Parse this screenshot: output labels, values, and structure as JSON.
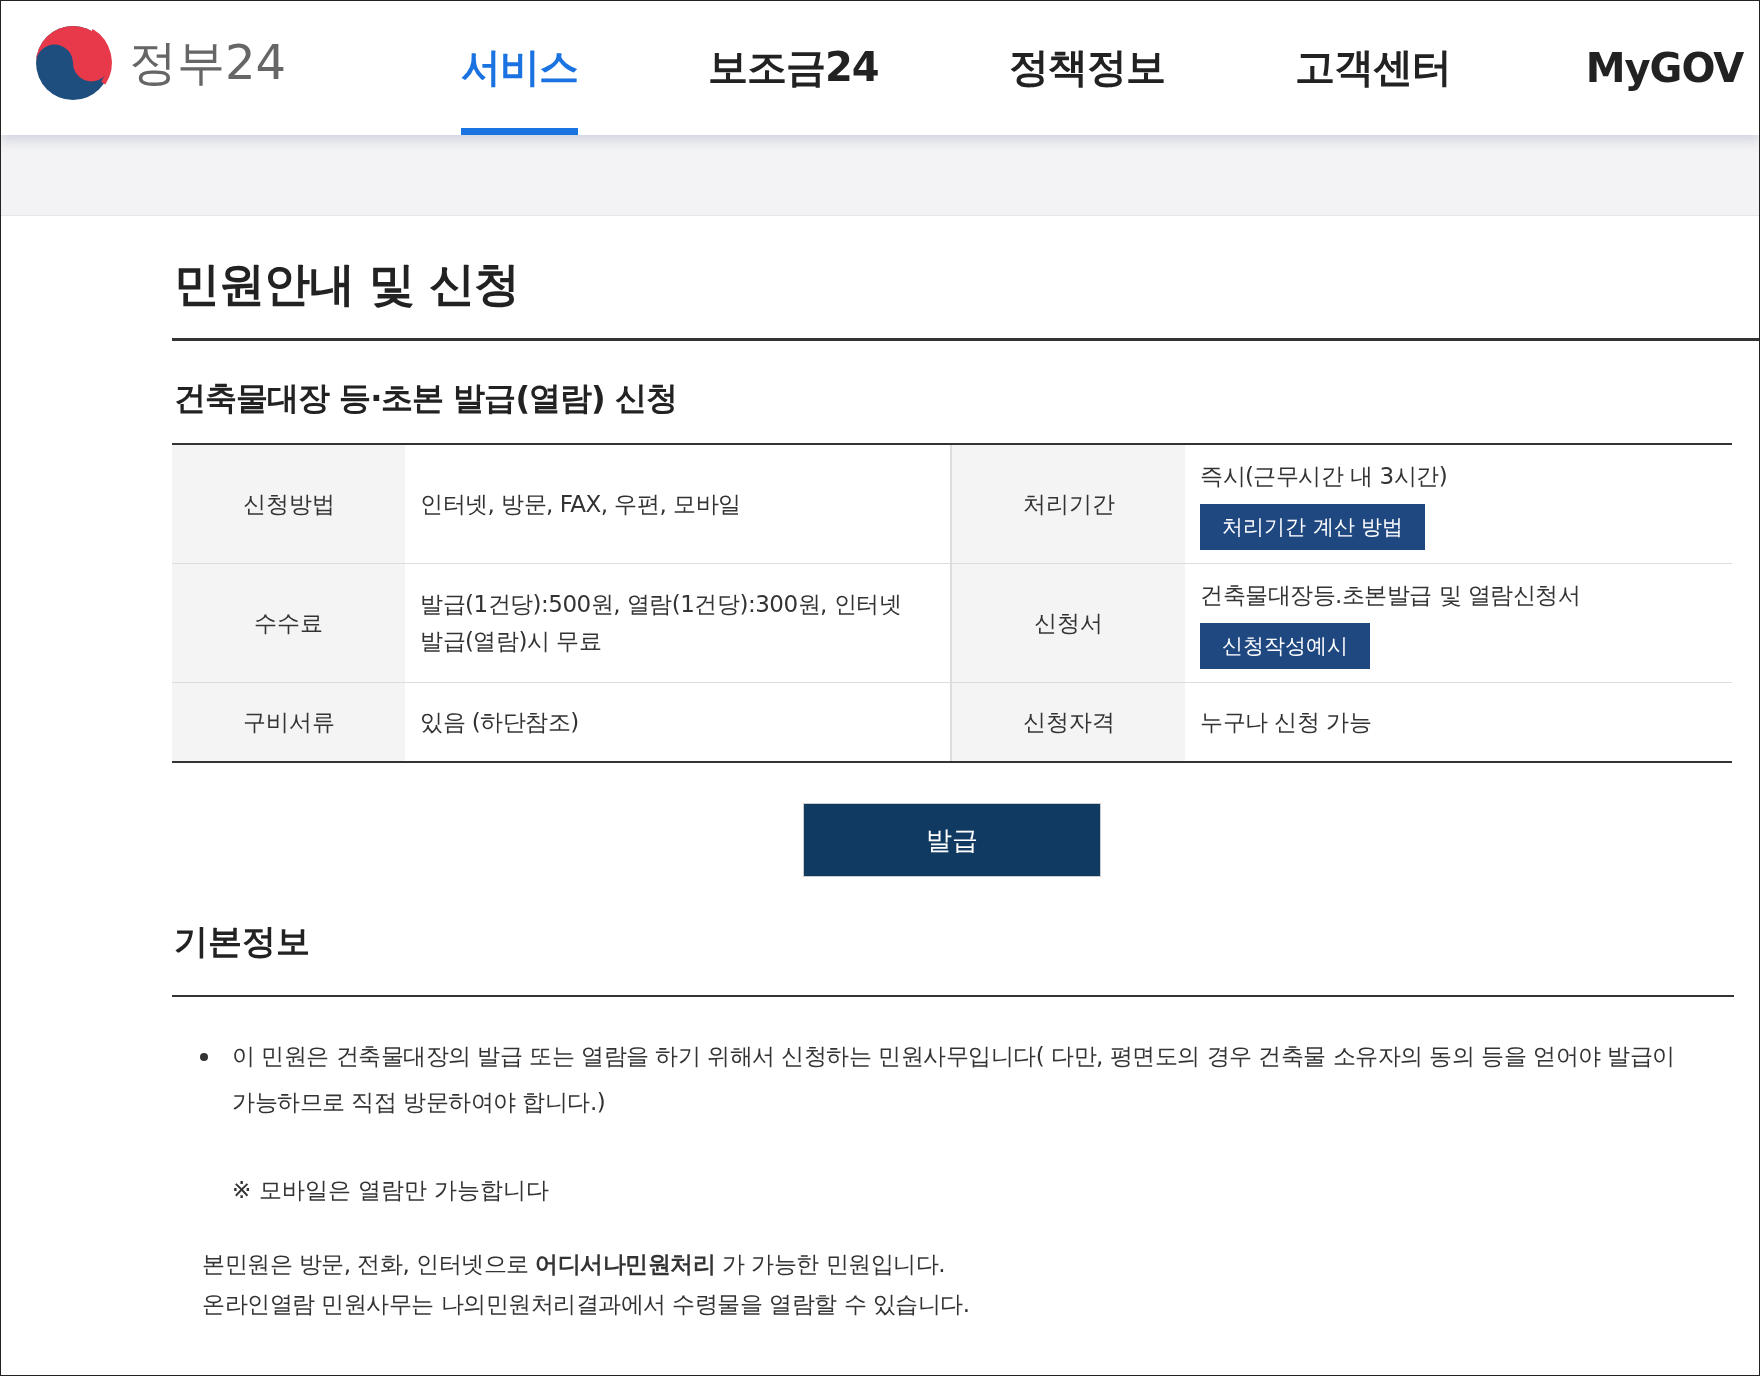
{
  "header": {
    "logo_text": "정부24",
    "nav": [
      {
        "label": "서비스",
        "selected": true
      },
      {
        "label": "보조금24",
        "selected": false
      },
      {
        "label": "정책정보",
        "selected": false
      },
      {
        "label": "고객센터",
        "selected": false
      },
      {
        "label": "MyGOV",
        "selected": false
      }
    ]
  },
  "page_title": "민원안내 및 신청",
  "service_title": "건축물대장 등·초본 발급(열람) 신청",
  "info_table": {
    "rows": [
      {
        "cells": [
          {
            "label": "신청방법",
            "value": "인터넷, 방문, FAX, 우편, 모바일"
          },
          {
            "label": "처리기간",
            "value": "즉시(근무시간 내 3시간)",
            "button": "처리기간 계산 방법"
          }
        ]
      },
      {
        "cells": [
          {
            "label": "수수료",
            "value": "발급(1건당):500원, 열람(1건당):300원, 인터넷 발급(열람)시 무료"
          },
          {
            "label": "신청서",
            "value": "건축물대장등.초본발급 및 열람신청서",
            "button": "신청작성예시"
          }
        ]
      },
      {
        "cells": [
          {
            "label": "구비서류",
            "value": "있음 (하단참조)"
          },
          {
            "label": "신청자격",
            "value": "누구나 신청 가능"
          }
        ]
      }
    ]
  },
  "issue_button": "발급",
  "basic_info": {
    "heading": "기본정보",
    "bullets": [
      "이 민원은 건축물대장의 발급 또는 열람을 하기 위해서 신청하는 민원사무입니다( 다만, 평면도의 경우 건축물 소유자의 동의 등을 얻어야 발급이 가능하므로 직접 방문하여야 합니다.)"
    ],
    "note": "※ 모바일은 열람만 가능합니다",
    "lines": [
      "본민원은 방문, 전화, 인터넷으로 **어디서나민원처리** 가 가능한 민원입니다.",
      "온라인열람 민원사무는 나의민원처리결과에서 수령물을 열람할 수 있습니다."
    ]
  }
}
